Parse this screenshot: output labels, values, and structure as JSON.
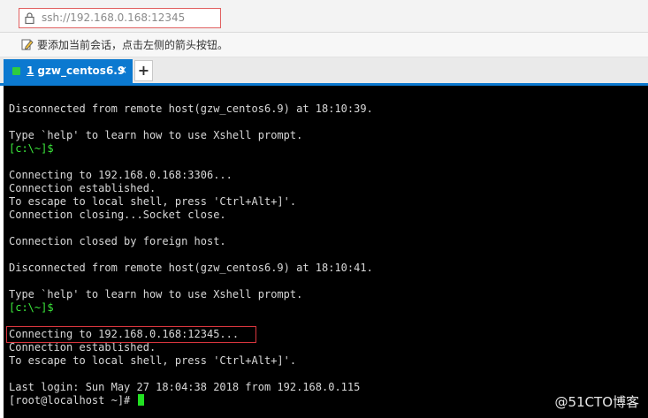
{
  "address_bar": {
    "value": "ssh://192.168.0.168:12345"
  },
  "hint_bar": {
    "text": "要添加当前会话，点击左侧的箭头按钮。"
  },
  "tabs": {
    "items": [
      {
        "number": "1",
        "label": "gzw_centos6.9",
        "close": "×"
      }
    ],
    "add_label": "+"
  },
  "terminal": {
    "lines": [
      {
        "text": "Disconnected from remote host(gzw_centos6.9) at 18:10:39.",
        "kind": "normal"
      },
      {
        "text": "",
        "kind": "normal"
      },
      {
        "text": "Type `help' to learn how to use Xshell prompt.",
        "kind": "normal"
      },
      {
        "text": "[c:\\~]$",
        "kind": "prompt"
      },
      {
        "text": "",
        "kind": "normal"
      },
      {
        "text": "Connecting to 192.168.0.168:3306...",
        "kind": "normal"
      },
      {
        "text": "Connection established.",
        "kind": "normal"
      },
      {
        "text": "To escape to local shell, press 'Ctrl+Alt+]'.",
        "kind": "normal"
      },
      {
        "text": "Connection closing...Socket close.",
        "kind": "normal"
      },
      {
        "text": "",
        "kind": "normal"
      },
      {
        "text": "Connection closed by foreign host.",
        "kind": "normal"
      },
      {
        "text": "",
        "kind": "normal"
      },
      {
        "text": "Disconnected from remote host(gzw_centos6.9) at 18:10:41.",
        "kind": "normal"
      },
      {
        "text": "",
        "kind": "normal"
      },
      {
        "text": "Type `help' to learn how to use Xshell prompt.",
        "kind": "normal"
      },
      {
        "text": "[c:\\~]$",
        "kind": "prompt"
      },
      {
        "text": "",
        "kind": "normal"
      },
      {
        "text": "Connecting to 192.168.0.168:12345...",
        "kind": "normal"
      },
      {
        "text": "Connection established.",
        "kind": "normal"
      },
      {
        "text": "To escape to local shell, press 'Ctrl+Alt+]'.",
        "kind": "normal"
      },
      {
        "text": "",
        "kind": "normal"
      },
      {
        "text": "Last login: Sun May 27 18:04:38 2018 from 192.168.0.115",
        "kind": "normal"
      },
      {
        "text": "[root@localhost ~]# ",
        "kind": "shell"
      }
    ]
  },
  "watermark": "@51CTO博客",
  "colors": {
    "tab_active": "#0b79d0",
    "prompt_green": "#3ce93c",
    "annotation_red": "#d9363e",
    "terminal_bg": "#000000"
  }
}
